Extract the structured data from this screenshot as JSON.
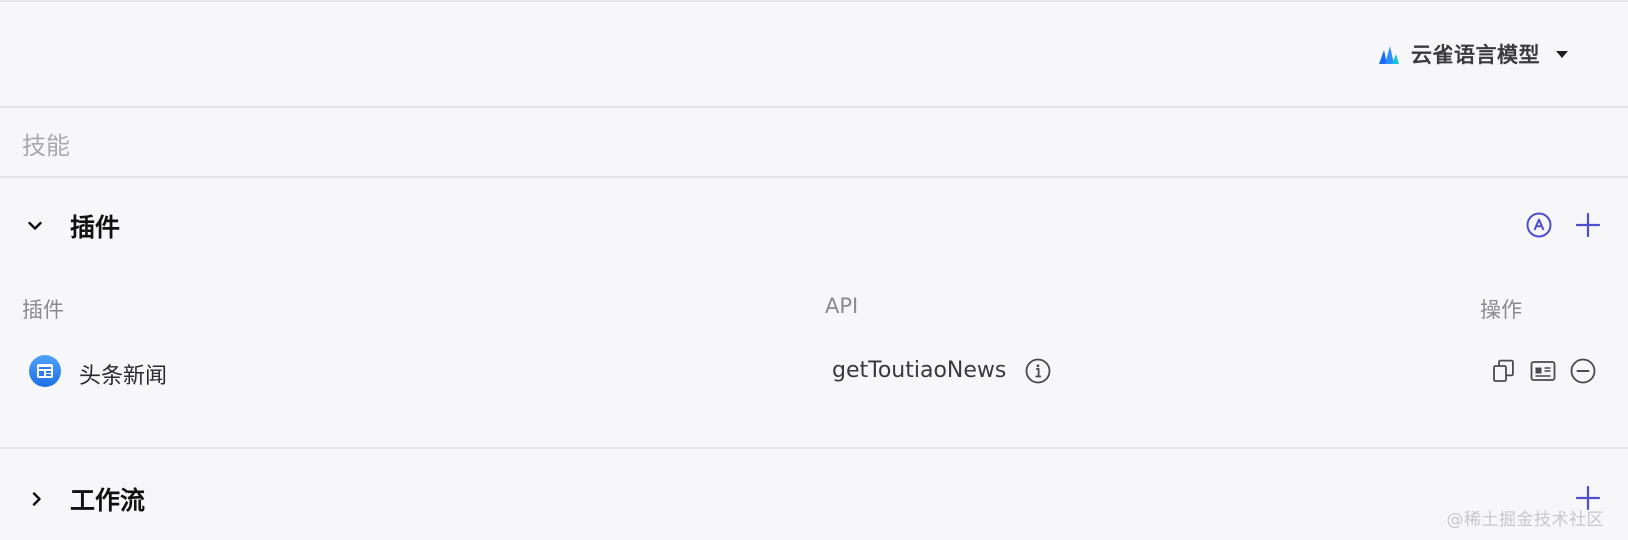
{
  "model": {
    "name": "云雀语言模型",
    "brand_color": "#1a6cf2"
  },
  "skill": {
    "title": "技能"
  },
  "plugin_section": {
    "title": "插件",
    "icons": {
      "collapse": "chevron-down-icon",
      "auto": "auto-circle-icon",
      "add": "plus-icon"
    },
    "accent": "#4e4ecf",
    "columns": [
      "插件",
      "API",
      "操作"
    ],
    "rows": [
      {
        "plugin": "头条新闻",
        "api": "getToutiaoNews",
        "icon": "news-icon",
        "actions": [
          "copy-icon",
          "card-icon",
          "remove-circle-icon"
        ]
      }
    ]
  },
  "workflow_section": {
    "title": "工作流",
    "icons": {
      "expand": "chevron-right-icon",
      "add": "plus-icon"
    }
  },
  "watermark": "@稀土掘金技术社区"
}
